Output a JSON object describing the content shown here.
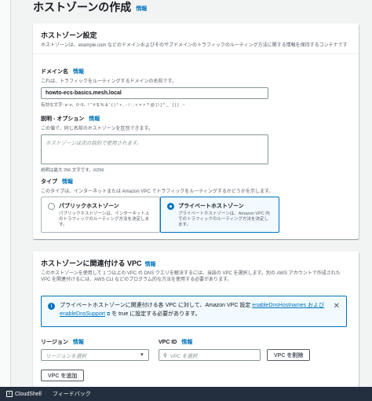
{
  "page": {
    "title": "ホストゾーンの作成",
    "info": "情報"
  },
  "settings": {
    "title": "ホストゾーン設定",
    "description": "ホストゾーンは、example.com などのドメインおよびそのサブドメインのトラフィックのルーティング方法に関する情報を保持するコンテナです",
    "domain": {
      "label": "ドメイン名",
      "info": "情報",
      "description": "これは、トラフィックをルーティングするドメインの名前です。",
      "value": "howto-ecs-basics.mesh.local",
      "constraint": "有効な文字: a~z、0~9、! \" # $ % & ' ( ) * + , - / : ; < = > ? @ [ \\ ] ^ _ ` { | } . ~"
    },
    "description_field": {
      "label": "説明 - オプション",
      "info": "情報",
      "description": "この値で、同じ名前のホストゾーンを区別できます。",
      "placeholder": "ホストゾーンは次の目的で使用されます。",
      "constraint": "説明は最大 256 文字です。0/256"
    },
    "type": {
      "label": "タイプ",
      "info": "情報",
      "description": "このタイプは、インターネットまたは Amazon VPC でトラフィックをルーティングするかどうかを示します。",
      "options": [
        {
          "title": "パブリックホストゾーン",
          "description": "パブリックホストゾーンは、インターネット上のトラフィックのルーティング方法を決定します。",
          "selected": false
        },
        {
          "title": "プライベートホストゾーン",
          "description": "プライベートホストゾーンは、Amazon VPC 内でのトラフィックのルーティング方法を決定します。",
          "selected": true
        }
      ]
    }
  },
  "vpc": {
    "title": "ホストゾーンに関連付ける VPC",
    "info": "情報",
    "description": "このホストゾーンを使用して 1 つ以上の VPC の DNS クエリを解決するには、当該の VPC を選択します。別の AWS アカウントで作成された VPC を関連付けるには、AWS CLI などのプログラム的な方法を使用する必要があります。",
    "alert": {
      "text_before": "プライベートホストゾーンに関連付ける各 VPC に対して、Amazon VPC 設定",
      "link1": "enableDnsHostnames および enableDnsSupport",
      "text_after": "を true に設定する必要があります。"
    },
    "region": {
      "label": "リージョン",
      "info": "情報",
      "placeholder": "リージョンを選択"
    },
    "vpc_id": {
      "label": "VPC ID",
      "info": "情報",
      "placeholder": "VPC を選択"
    },
    "remove_button": "VPC を削除",
    "add_button": "VPC を追加"
  },
  "footer": {
    "cloudshell": "CloudShell",
    "feedback": "フィードバック"
  },
  "colors": {
    "accent": "#0073bb",
    "footer_bg": "#232f3e"
  }
}
